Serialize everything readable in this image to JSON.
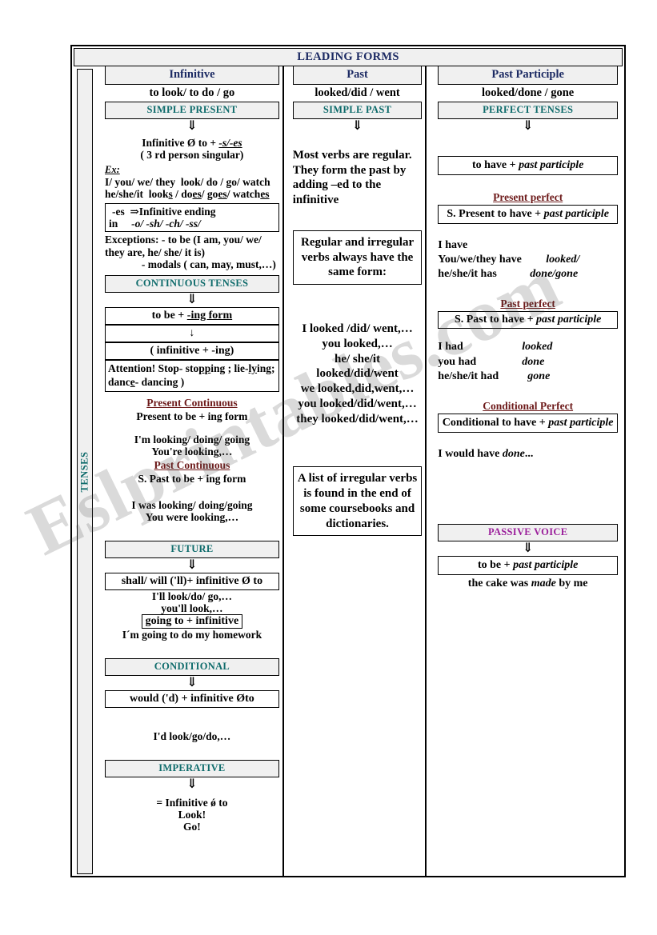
{
  "document": {
    "title": "LEADING FORMS",
    "spine_label": "TENSES",
    "watermark": "Eslprintables.com"
  },
  "colors": {
    "title_navy": "#1c2a63",
    "section_teal": "#0e6b6b",
    "subsection_maroon": "#6d1a1a",
    "passive_violet": "#9b1f9b",
    "header_fill": "#f0f0f0"
  },
  "columns": {
    "infinitive": {
      "header": "Infinitive",
      "forms": "to look/ to do / go",
      "section": "SIMPLE PRESENT",
      "arrow": "⇓",
      "rule": "Infinitive Ø to + -s/-es",
      "rule_note": "( 3 rd person singular)",
      "ex_label": "Ex:",
      "ex_line1": "I/ you/ we/ they  look/ do / go/ watch",
      "ex_line2": "he/she/it  looks / does/ goes/ watches",
      "es_box_line1": "-es ⇒Infinitive ending",
      "es_box_line2": "in      -o/ -sh/ -ch/ -ss/",
      "exceptions_line1": "Exceptions:  - to be (I am, you/ we/ they are, he/ she/ it is)",
      "exceptions_line2": "- modals ( can, may, must,…)",
      "continuous": {
        "section": "CONTINUOUS TENSES",
        "arrow": "⇓",
        "rule": "to be + -ing form",
        "down_arrow": "↓",
        "rule2": "( infinitive + -ing)",
        "attention": "Attention! Stop- stopping ; lie-lying; dance- dancing )",
        "present": {
          "label": "Present Continuous",
          "formula": "Present to be + ing form",
          "ex1": "I'm looking/ doing/ going",
          "ex2": "You're looking,…"
        },
        "past": {
          "label": "Past Continuous",
          "formula": "S. Past to be + ing form",
          "ex1": "I was looking/ doing/going",
          "ex2": "You were looking,…"
        }
      },
      "future": {
        "section": "FUTURE",
        "arrow": "⇓",
        "rule": "shall/ will ('ll)+ infinitive Ø to",
        "ex1": "I'll look/do/ go,…",
        "ex2": "you'll look,…",
        "rule2": "going to + infinitive",
        "ex3": "I´m going to do my homework"
      },
      "conditional": {
        "section": "CONDITIONAL",
        "arrow": "⇓",
        "rule": "would ('d) + infinitive Øto",
        "ex1": "I'd look/go/do,…"
      },
      "imperative": {
        "section": "IMPERATIVE",
        "arrow": "⇓",
        "rule": "= Infinitive ǿ to",
        "ex1": "Look!",
        "ex2": "Go!"
      }
    },
    "past": {
      "header": "Past",
      "forms": "looked/did / went",
      "section": "SIMPLE PAST",
      "arrow": "⇓",
      "note": "Most verbs are regular. They form the past by adding –ed to the infinitive",
      "same_form_box": "Regular and irregular verbs always have the same form:",
      "paradigm": [
        "I looked /did/ went,…",
        "you looked,…",
        "he/ she/it looked/did/went",
        "we looked,did,went,…",
        "you looked/did/went,…",
        "they looked/did/went,…"
      ],
      "irregular_box": "A list of irregular verbs is found in the end of some coursebooks and dictionaries."
    },
    "past_participle": {
      "header": "Past Participle",
      "forms": "looked/done / gone",
      "section": "PERFECT TENSES",
      "arrow": "⇓",
      "rule": "to have + past participle",
      "present_perfect": {
        "label": "Present  perfect",
        "formula": "S. Present to have + past participle",
        "rows": [
          {
            "subject": "I have",
            "value": ""
          },
          {
            "subject": "You/we/they have",
            "value": "looked/"
          },
          {
            "subject": "he/she/it has",
            "value": "done/gone"
          }
        ]
      },
      "past_perfect": {
        "label": "Past perfect",
        "formula": "S. Past to have + past participle",
        "rows": [
          {
            "subject": "I had",
            "value": "looked"
          },
          {
            "subject": "you had",
            "value": "done"
          },
          {
            "subject": "he/she/it had",
            "value": "gone"
          }
        ]
      },
      "conditional_perfect": {
        "label": "Conditional Perfect",
        "formula": "Conditional to have + past participle",
        "example": "I would have done..."
      },
      "passive": {
        "section": "PASSIVE VOICE",
        "arrow": "⇓",
        "rule": "to be + past participle",
        "example": "the cake was made by me"
      }
    }
  }
}
